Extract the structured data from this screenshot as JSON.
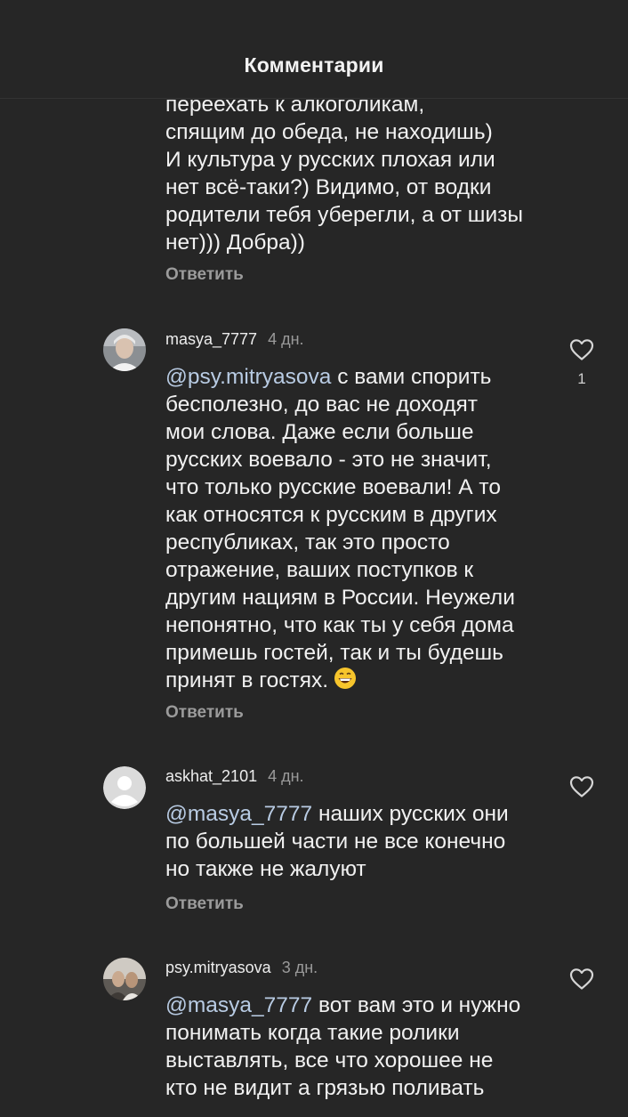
{
  "header": {
    "title": "Комментарии"
  },
  "reply_label": "Ответить",
  "comments": [
    {
      "text": "переехать к алкоголикам,\nспящим до обеда, не находишь)\nИ культура у русских плохая или\nнет всё-таки?) Видимо, от водки\nродители тебя уберегли, а от шизы\nнет))) Добра))"
    },
    {
      "username": "masya_7777",
      "time": "4 дн.",
      "mention": "@psy.mitryasova",
      "text": " с вами спорить\nбесполезно, до вас не доходят\nмои слова. Даже если больше\nрусских воевало - это не значит,\nчто только русские воевали! А то\nкак относятся к русским в других\nреспубликах, так это просто\nотражение, ваших поступков к\nдругим нациям в России. Неужели\nнепонятно, что как ты у себя дома\nпримешь гостей, так и ты будешь\nпринят в гостях.",
      "likes": "1"
    },
    {
      "username": "askhat_2101",
      "time": "4 дн.",
      "mention": "@masya_7777",
      "text": " наших русских они\nпо большей части не все конечно\nно также не жалуют"
    },
    {
      "username": "psy.mitryasova",
      "time": "3 дн.",
      "mention": "@masya_7777",
      "text": " вот вам это и нужно\nпонимать когда такие ролики\nвыставлять, все что хорошее не\nкто не видит а грязью поливать"
    }
  ],
  "colors": {
    "background": "#262626",
    "text": "#f1f1f1",
    "secondary": "#9b9b9b",
    "mention": "#b8cbe3"
  },
  "icons": {
    "like": "heart-outline-icon",
    "emoji": "grinning-face-icon"
  }
}
